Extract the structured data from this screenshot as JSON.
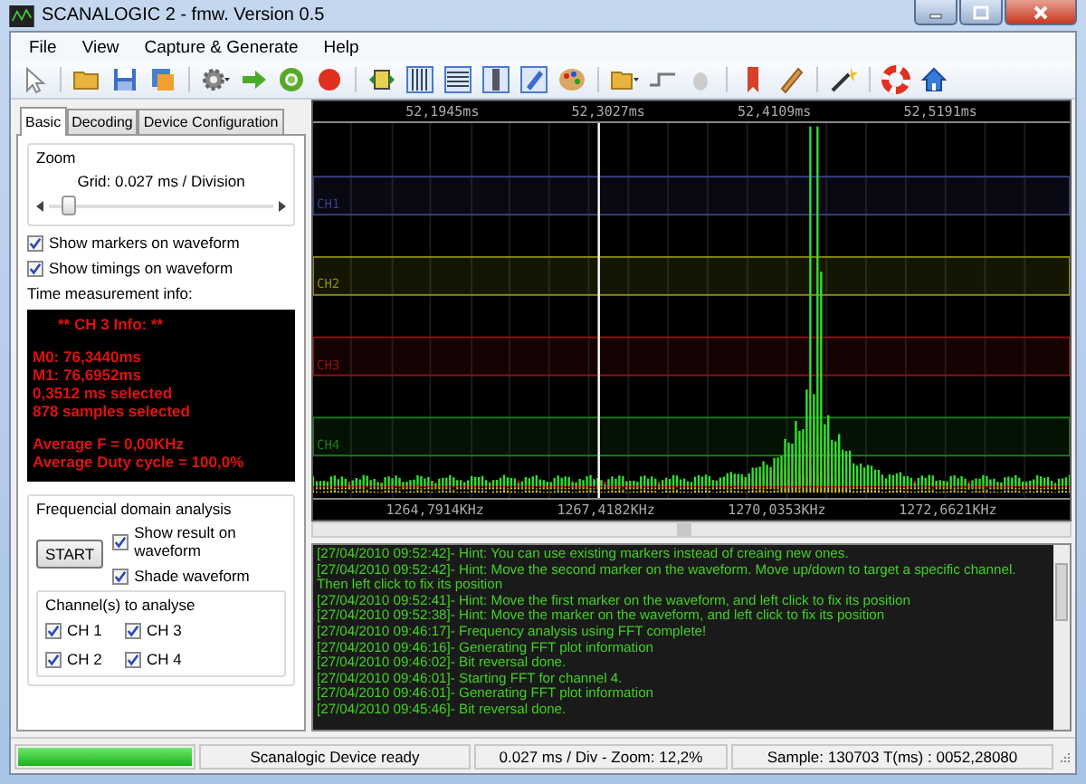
{
  "window": {
    "title": "SCANALOGIC 2 - fmw. Version 0.5"
  },
  "menu": [
    "File",
    "View",
    "Capture & Generate",
    "Help"
  ],
  "tabs": [
    {
      "label": "Basic",
      "selected": true
    },
    {
      "label": "Decoding",
      "selected": false
    },
    {
      "label": "Device Configuration",
      "selected": false
    }
  ],
  "zoom": {
    "title": "Zoom",
    "grid_label": "Grid:  0.027 ms / Division",
    "level": 0.06
  },
  "options": [
    {
      "label": "Show markers on waveform",
      "checked": true
    },
    {
      "label": "Show timings on waveform",
      "checked": true
    }
  ],
  "time_info": {
    "title": "Time measurement info:",
    "header": "** CH 3 Info: **",
    "lines": [
      "M0: 76,3440ms",
      "M1: 76,6952ms",
      "0,3512 ms selected",
      "878 samples selected"
    ],
    "averages": [
      "Average F = 0,00KHz",
      "Average Duty cycle = 100,0%"
    ]
  },
  "fft": {
    "title": "Frequencial domain analysis",
    "start_button": "START",
    "options": [
      {
        "label": "Show result on waveform",
        "checked": true
      },
      {
        "label": "Shade waveform",
        "checked": true
      }
    ],
    "channels_title": "Channel(s) to analyse",
    "channels": [
      {
        "label": "CH 1",
        "checked": true
      },
      {
        "label": "CH 3",
        "checked": true
      },
      {
        "label": "CH 2",
        "checked": true
      },
      {
        "label": "CH 4",
        "checked": true
      }
    ]
  },
  "waveform": {
    "time_labels": [
      "52,1945ms",
      "52,3027ms",
      "52,4109ms",
      "52,5191ms"
    ],
    "channels": [
      {
        "label": "CH1",
        "color": "#3a3f80"
      },
      {
        "label": "CH2",
        "color": "#8a8a18"
      },
      {
        "label": "CH3",
        "color": "#8c1414"
      },
      {
        "label": "CH4",
        "color": "#1c7a1c"
      }
    ],
    "freq_labels": [
      "1264,7914KHz",
      "1267,4182KHz",
      "1270,0353KHz",
      "1272,6621KHz"
    ]
  },
  "log": [
    "[27/04/2010 09:52:42]- Hint: You can use existing markers instead of creaing new ones.",
    "[27/04/2010 09:52:42]- Hint: Move the second marker on the waveform. Move up/down to target a specific channel. Then left click to fix its position",
    "[27/04/2010 09:52:41]- Hint: Move the first marker on the waveform, and left click to fix its position",
    "[27/04/2010 09:52:38]- Hint: Move the marker on the waveform, and left click to fix its position",
    "[27/04/2010 09:46:17]- Frequency analysis using FFT complete!",
    "[27/04/2010 09:46:16]- Generating FFT plot information",
    "[27/04/2010 09:46:02]- Bit reversal done.",
    "[27/04/2010 09:46:01]- Starting FFT for channel 4.",
    "[27/04/2010 09:46:01]- Generating FFT plot information",
    "[27/04/2010 09:45:46]- Bit reversal done."
  ],
  "status_bar": {
    "progress": {
      "level": 1
    },
    "message": "Scanalogic Device ready",
    "zoom": "0.027 ms / Div  -  Zoom: 12,2%",
    "sample": "Sample: 130703   T(ms) : 0052,28080"
  }
}
